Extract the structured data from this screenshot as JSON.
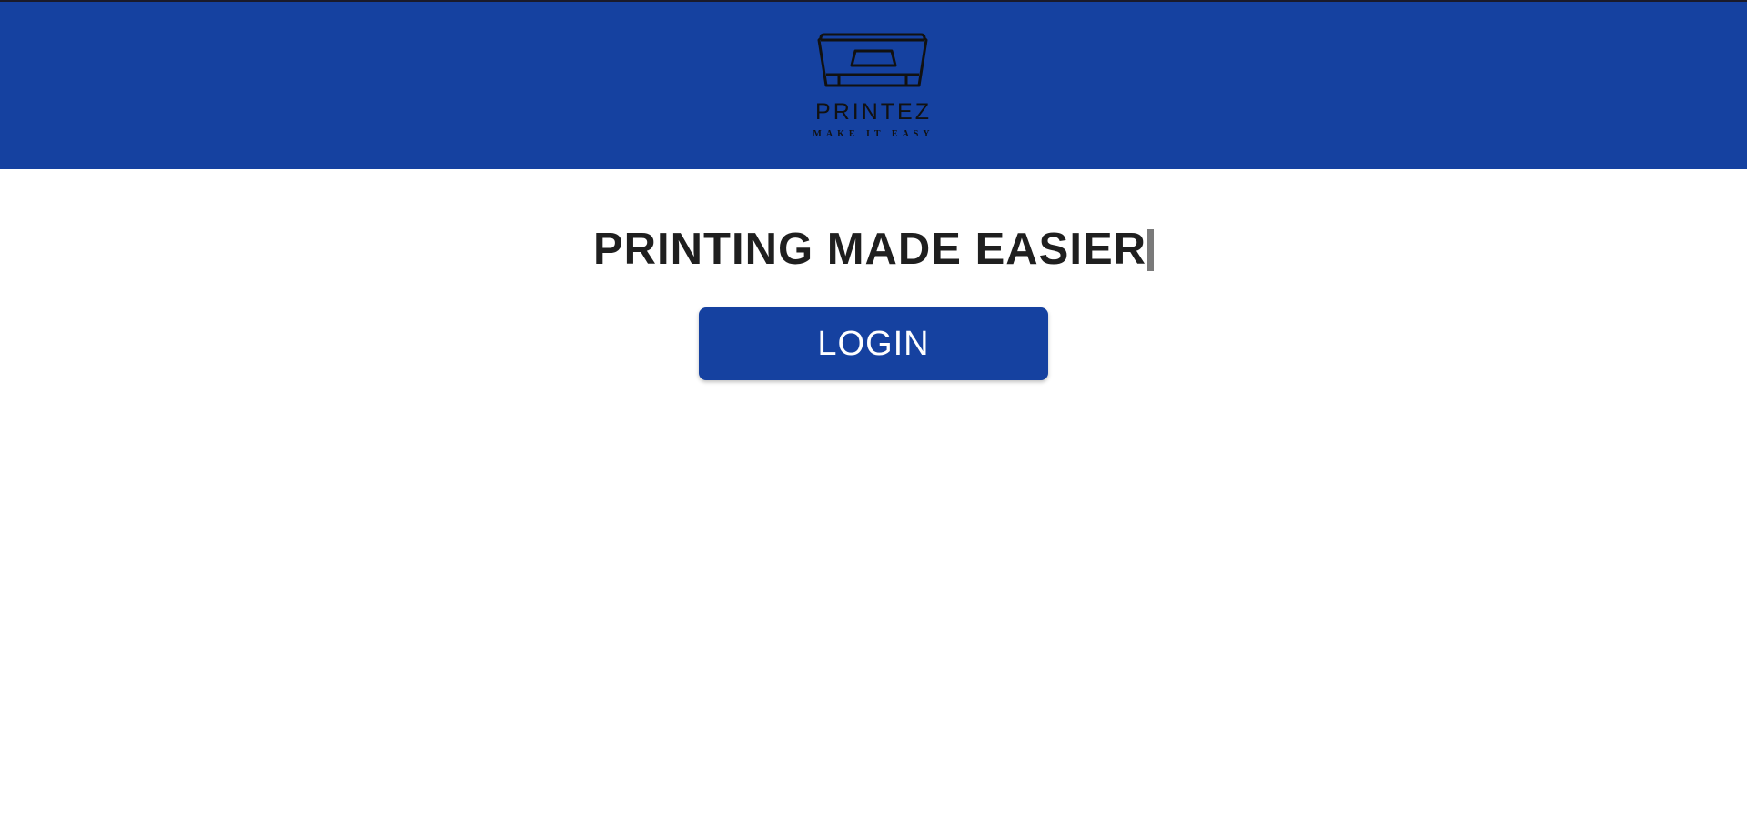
{
  "header": {
    "brand_name": "PRINTEZ",
    "brand_tagline": "MAKE IT EASY",
    "logo_icon": "printer-icon",
    "background_color": "#1541a0"
  },
  "main": {
    "headline": "PRINTING MADE EASIER",
    "login_button_label": "LOGIN"
  },
  "colors": {
    "accent": "#1541a0",
    "headline_text": "#1f1f1f",
    "button_text": "#ffffff"
  }
}
